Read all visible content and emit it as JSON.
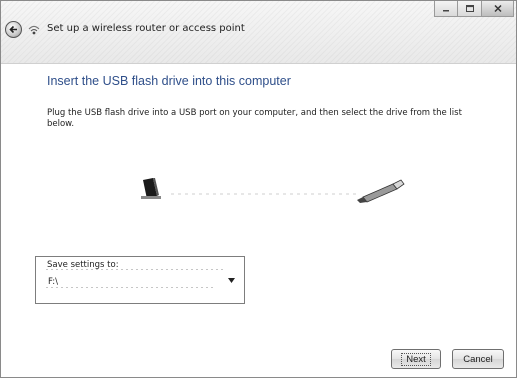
{
  "window": {
    "title": "Set up a wireless router or access point",
    "controls": [
      "minimize-icon",
      "maximize-icon",
      "close-icon"
    ]
  },
  "nav": {
    "back_icon": "back-arrow-icon",
    "wizard_icon": "wireless-network-icon"
  },
  "main": {
    "heading": "Insert the USB flash drive into this computer",
    "instructions": "Plug the USB flash drive into a USB port on your computer, and then select the drive from the list below.",
    "illustration_icons": [
      "computer-icon",
      "usb-flash-drive-icon"
    ]
  },
  "drive": {
    "label": "Save settings to:",
    "selected": "F:\\"
  },
  "buttons": {
    "next": "Next",
    "cancel": "Cancel"
  },
  "colors": {
    "heading": "#2f4f8a",
    "border": "#7d7d7d"
  }
}
